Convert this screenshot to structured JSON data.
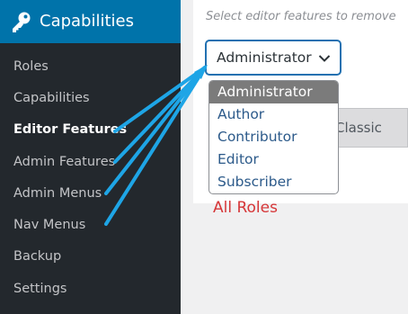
{
  "sidebar": {
    "header_title": "Capabilities",
    "items": [
      {
        "label": "Roles",
        "active": false
      },
      {
        "label": "Capabilities",
        "active": false
      },
      {
        "label": "Editor Features",
        "active": true
      },
      {
        "label": "Admin Features",
        "active": false
      },
      {
        "label": "Admin Menus",
        "active": false
      },
      {
        "label": "Nav Menus",
        "active": false
      },
      {
        "label": "Backup",
        "active": false
      },
      {
        "label": "Settings",
        "active": false
      }
    ]
  },
  "main": {
    "hint_text": "Select editor features to remove",
    "role_select": {
      "value": "Administrator",
      "options": [
        "Administrator",
        "Author",
        "Contributor",
        "Editor",
        "Subscriber"
      ]
    },
    "tab_label": "Classic",
    "annotation": "All Roles"
  },
  "colors": {
    "sidebar_bg": "#23282d",
    "header_bg": "#0073aa",
    "arrow_color": "#1ea5e6",
    "annotation_color": "#d63638",
    "selected_option_bg": "#7b7b7b"
  }
}
